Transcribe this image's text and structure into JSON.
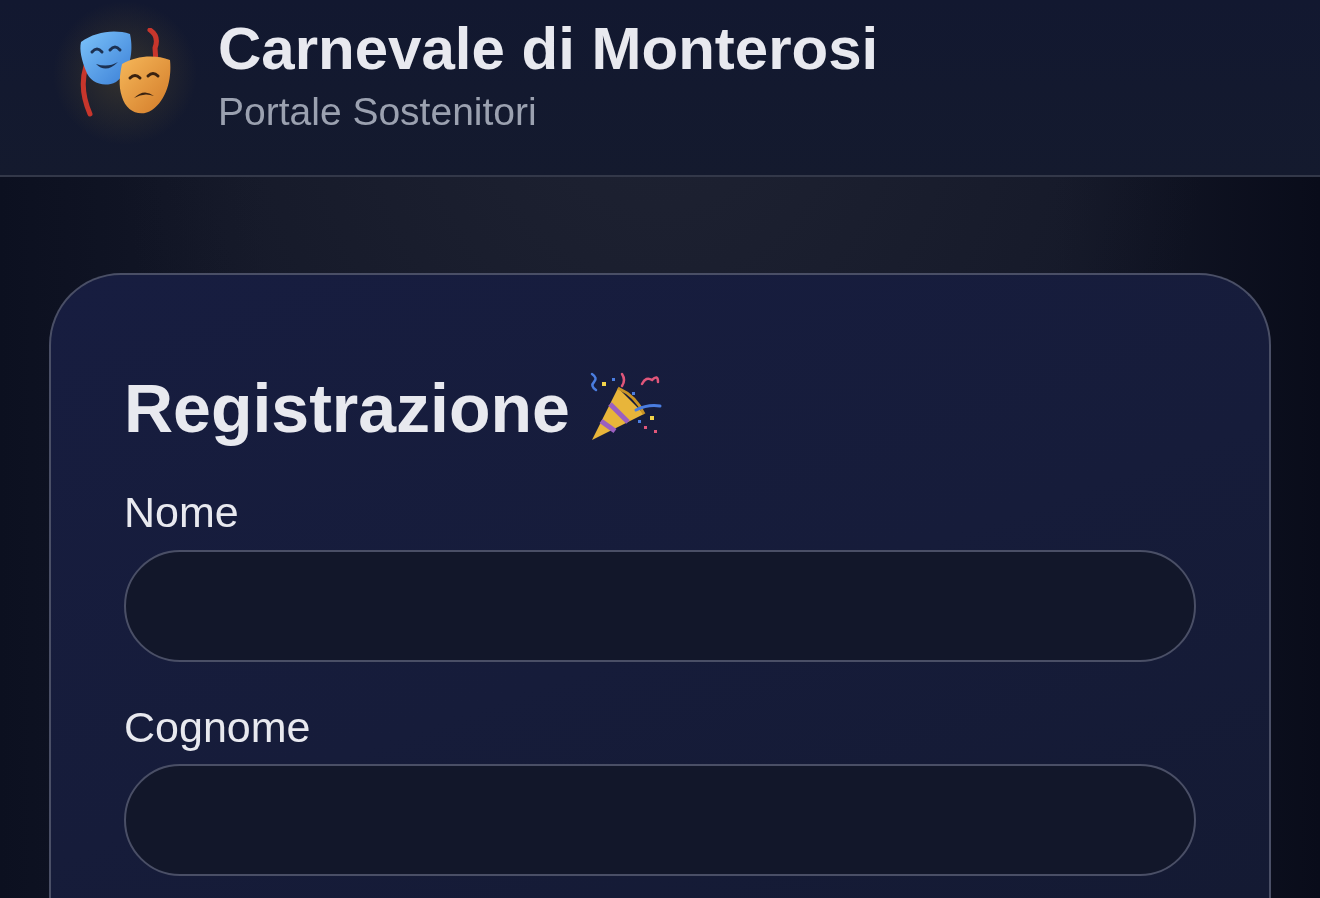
{
  "header": {
    "title": "Carnevale di Monterosi",
    "subtitle": "Portale Sostenitori"
  },
  "form": {
    "title": "Registrazione",
    "fields": [
      {
        "label": "Nome"
      },
      {
        "label": "Cognome"
      }
    ]
  }
}
